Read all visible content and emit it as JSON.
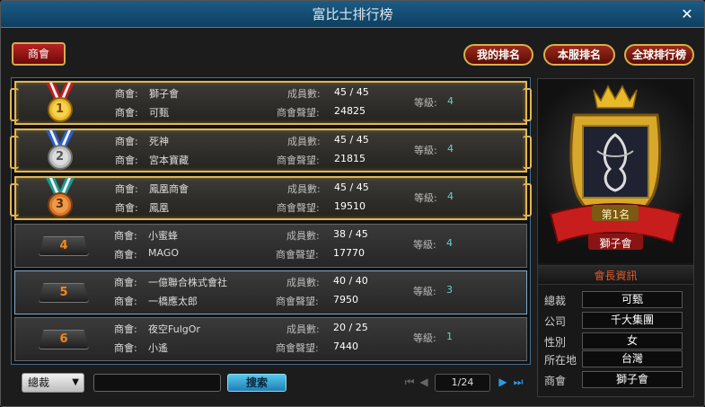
{
  "window": {
    "title": "富比士排行榜",
    "close_label": "✕"
  },
  "tabs": {
    "guild": "商會"
  },
  "top_buttons": {
    "my_rank": "我的排名",
    "server_rank": "本服排名",
    "global_rank": "全球排行榜"
  },
  "rows": [
    {
      "rank": "1",
      "guild_label": "商會:",
      "guild_name": "獅子會",
      "leader_label": "商會:",
      "leader_name": "可甄",
      "members_label": "成員數:",
      "members": "45 / 45",
      "rep_label": "商會聲望:",
      "reputation": "24825",
      "level_label": "等級:",
      "level": "4"
    },
    {
      "rank": "2",
      "guild_label": "商會:",
      "guild_name": "死神",
      "leader_label": "商會:",
      "leader_name": "宮本寶藏",
      "members_label": "成員數:",
      "members": "45 / 45",
      "rep_label": "商會聲望:",
      "reputation": "21815",
      "level_label": "等級:",
      "level": "4"
    },
    {
      "rank": "3",
      "guild_label": "商會:",
      "guild_name": "鳳凰商會",
      "leader_label": "商會:",
      "leader_name": "鳳凰",
      "members_label": "成員數:",
      "members": "45 / 45",
      "rep_label": "商會聲望:",
      "reputation": "19510",
      "level_label": "等級:",
      "level": "4"
    },
    {
      "rank": "4",
      "guild_label": "商會:",
      "guild_name": "小蜜蜂",
      "leader_label": "商會:",
      "leader_name": "MAGO",
      "members_label": "成員數:",
      "members": "38 / 45",
      "rep_label": "商會聲望:",
      "reputation": "17770",
      "level_label": "等級:",
      "level": "4"
    },
    {
      "rank": "5",
      "guild_label": "商會:",
      "guild_name": "一億聯合株式會社",
      "leader_label": "商會:",
      "leader_name": "一橋應太郎",
      "members_label": "成員數:",
      "members": "40 / 40",
      "rep_label": "商會聲望:",
      "reputation": "7950",
      "level_label": "等級:",
      "level": "3"
    },
    {
      "rank": "6",
      "guild_label": "商會:",
      "guild_name": "夜空FulgOr",
      "leader_label": "商會:",
      "leader_name": "小遙",
      "members_label": "成員數:",
      "members": "20 / 25",
      "rep_label": "商會聲望:",
      "reputation": "7440",
      "level_label": "等級:",
      "level": "1"
    }
  ],
  "bottom": {
    "filter_value": "總裁",
    "search_placeholder": "",
    "search_label": "搜索",
    "page": "1/24"
  },
  "emblem": {
    "rank_text": "第1名",
    "guild_name": "獅子會"
  },
  "leader_info": {
    "header": "會長資訊",
    "fields": [
      {
        "label": "總裁",
        "value": "可甄"
      },
      {
        "label": "公司",
        "value": "千大集團"
      },
      {
        "label": "性別",
        "value": "女"
      },
      {
        "label": "所在地",
        "value": "台灣"
      },
      {
        "label": "商會",
        "value": "獅子會"
      }
    ]
  },
  "colors": {
    "title_bar": "#1a5c86",
    "gold": "#e0b657",
    "accent_red": "#b82222",
    "rank_orange": "#f08a1f",
    "level_cyan": "#6ad0c7"
  },
  "icons": {
    "medal_1": "gold-medal-icon",
    "medal_2": "silver-medal-icon",
    "medal_3": "bronze-medal-icon",
    "pager_first": "first-page-icon",
    "pager_prev": "prev-page-icon",
    "pager_next": "next-page-icon",
    "pager_last": "last-page-icon"
  }
}
